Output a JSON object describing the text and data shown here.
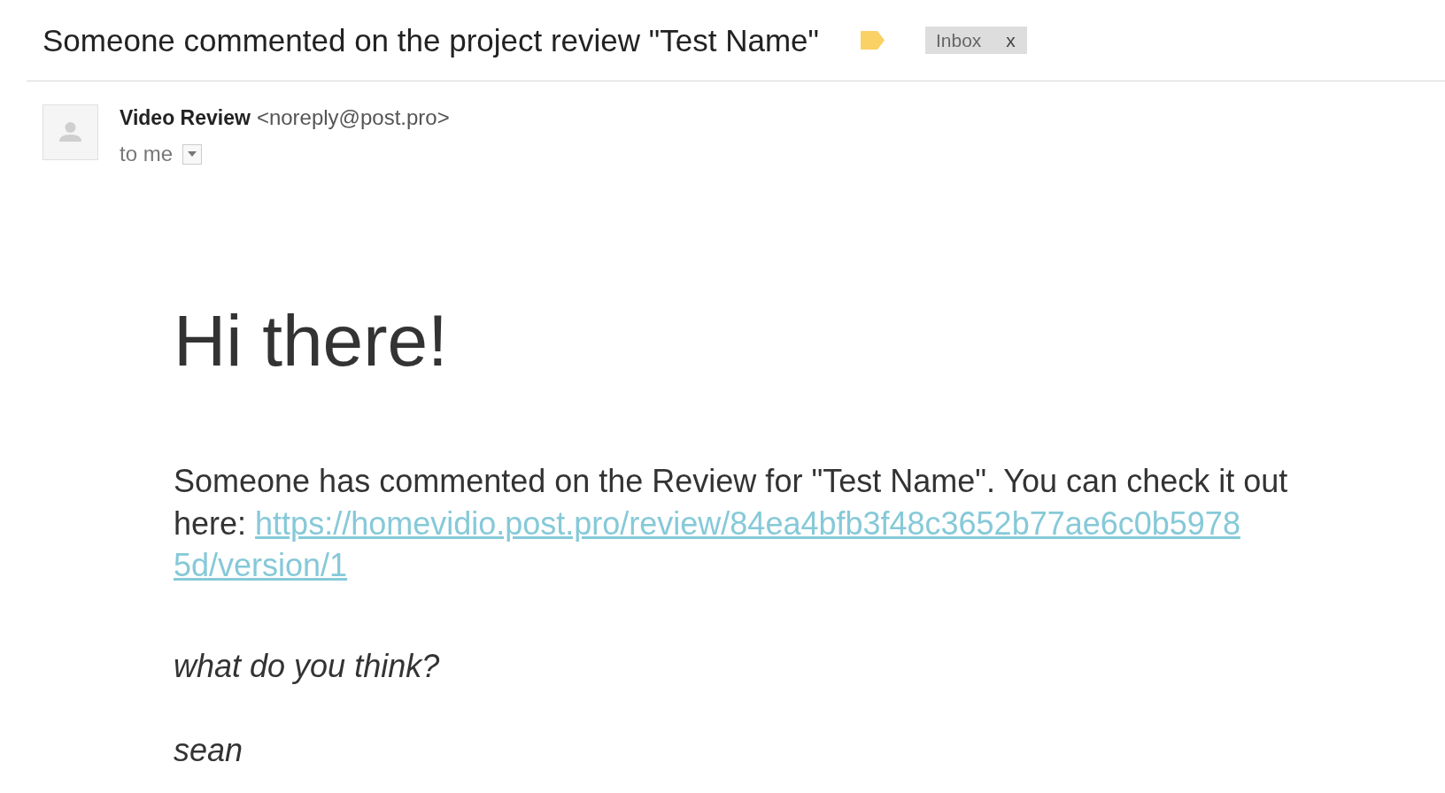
{
  "email": {
    "subject": "Someone commented on the project review \"Test Name\"",
    "labels": [
      {
        "name": "Inbox",
        "remove": "x"
      }
    ]
  },
  "sender": {
    "name": "Video Review",
    "address": "<noreply@post.pro>",
    "recipient": "to me"
  },
  "body": {
    "greeting": "Hi there!",
    "paragraph": "Someone has commented on the Review for \"Test Name\". You can check it out here:",
    "link_lines": [
      "https://homevidio.post.pro/review/84ea4bfb3f48c3652b77ae6c0b5978",
      "5d/version/1"
    ],
    "question": "what do you think?",
    "signature": "sean"
  }
}
